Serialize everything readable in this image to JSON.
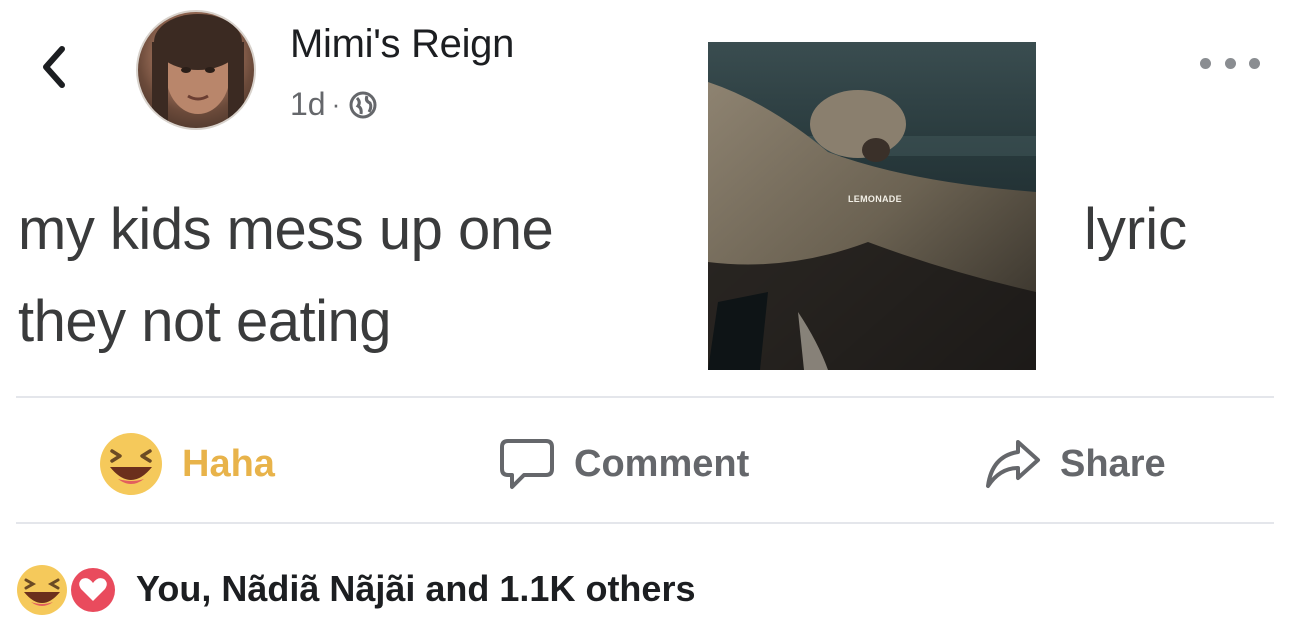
{
  "post": {
    "author": "Mimi's Reign",
    "time": "1d",
    "separator": "·",
    "privacy_icon": "globe-icon",
    "text_line1": "my kids mess up one",
    "text_word_after_image": "lyric",
    "text_line2": "they not eating",
    "inline_image": {
      "label": "LEMONADE"
    }
  },
  "actions": {
    "haha_label": "Haha",
    "comment_label": "Comment",
    "share_label": "Share"
  },
  "reactions": {
    "summary": "You, Nãdiã Nãjãi and 1.1K others",
    "icons": [
      "haha-reaction-icon",
      "love-reaction-icon"
    ]
  },
  "colors": {
    "haha_yellow": "#e8b34a",
    "gray_text": "#65676b",
    "love_red": "#e94b5d",
    "divider": "#e4e6eb"
  }
}
